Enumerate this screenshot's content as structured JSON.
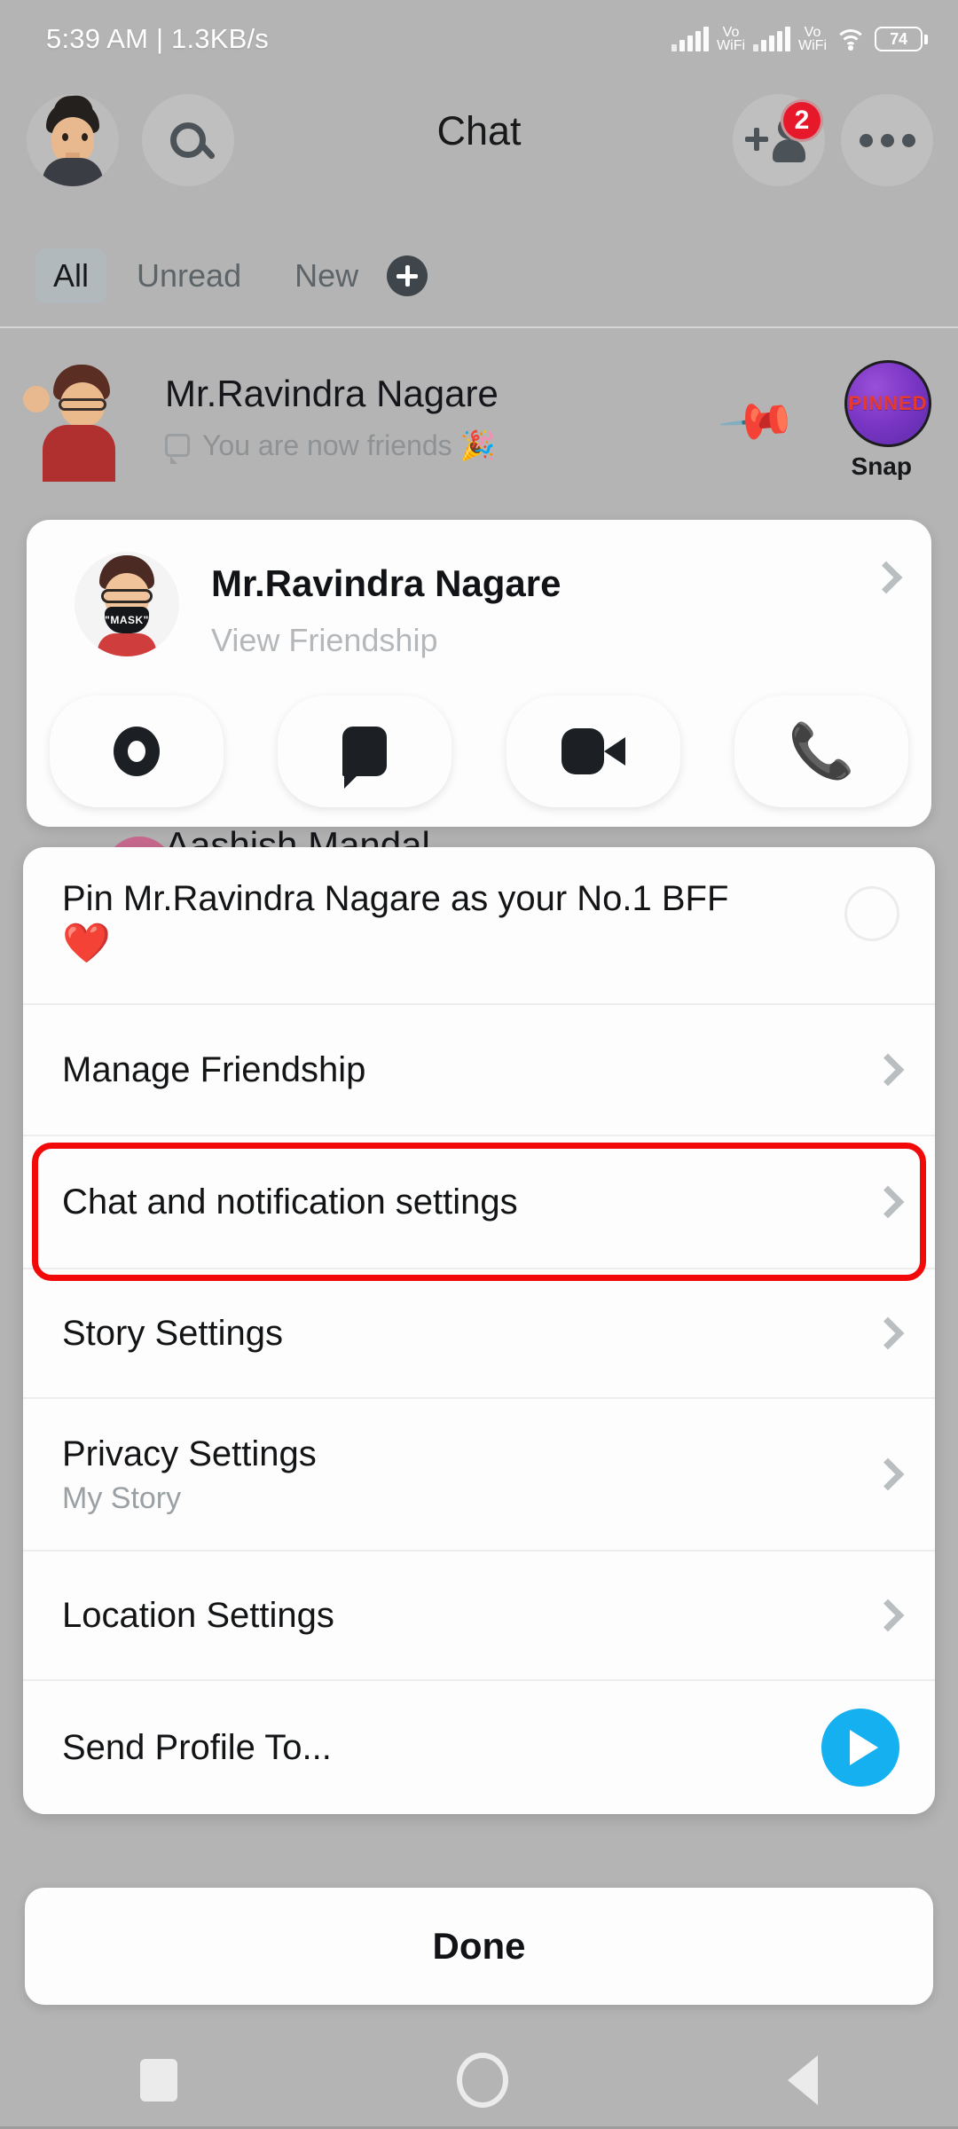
{
  "status_bar": {
    "time_and_speed": "5:39 AM | 1.3KB/s",
    "sim1_label": "Vo\nWiFi",
    "sim1_line1": "Vo",
    "sim1_line2": "WiFi",
    "sim2_line1": "Vo",
    "sim2_line2": "WiFi",
    "battery_percent": "74",
    "wifi_icon": "wifi-icon"
  },
  "app_bar": {
    "title": "Chat",
    "profile_icon": "profile-avatar-icon",
    "search_icon": "search-icon",
    "add_friend_icon": "add-friend-icon",
    "add_friend_badge": "2",
    "more_icon": "more-options-icon"
  },
  "filters": {
    "tabs": [
      {
        "label": "All",
        "active": true
      },
      {
        "label": "Unread",
        "active": false
      },
      {
        "label": "New",
        "active": false
      }
    ],
    "new_plus_icon": "plus-circle-icon"
  },
  "chat_list": {
    "rows": [
      {
        "name": "Mr.Ravindra Nagare",
        "subtitle": "You are now friends 🎉",
        "pin_icon": "pin-icon",
        "thumb_label": "PINNED",
        "thumb_caption": "Snap"
      },
      {
        "name": "Aashish Mandal"
      }
    ]
  },
  "friend_card": {
    "name": "Mr.Ravindra Nagare",
    "subtitle": "View Friendship",
    "avatar_mask_text": "\"MASK\"",
    "chevron_icon": "chevron-right-icon",
    "actions": [
      {
        "name": "camera-icon"
      },
      {
        "name": "chat-bubble-icon"
      },
      {
        "name": "video-camera-icon"
      },
      {
        "name": "phone-icon",
        "glyph": "📞"
      }
    ]
  },
  "action_sheet": {
    "items": [
      {
        "title": "Pin Mr.Ravindra Nagare as your No.1 BFF",
        "heart": "❤️",
        "control": "radio-circle",
        "checked": false
      },
      {
        "title": "Manage Friendship",
        "control": "chevron"
      },
      {
        "title": "Chat and notification settings",
        "control": "chevron",
        "highlighted": true
      },
      {
        "title": "Story Settings",
        "control": "chevron"
      },
      {
        "title": "Privacy Settings",
        "subtitle": "My Story",
        "control": "chevron"
      },
      {
        "title": "Location Settings",
        "control": "chevron"
      },
      {
        "title": "Send Profile To...",
        "control": "send-button"
      }
    ],
    "done_label": "Done"
  },
  "highlight": {
    "color": "#f20a0a"
  },
  "nav_bar": {
    "recents_icon": "recents-square-icon",
    "home_icon": "home-circle-icon",
    "back_icon": "back-triangle-icon"
  }
}
